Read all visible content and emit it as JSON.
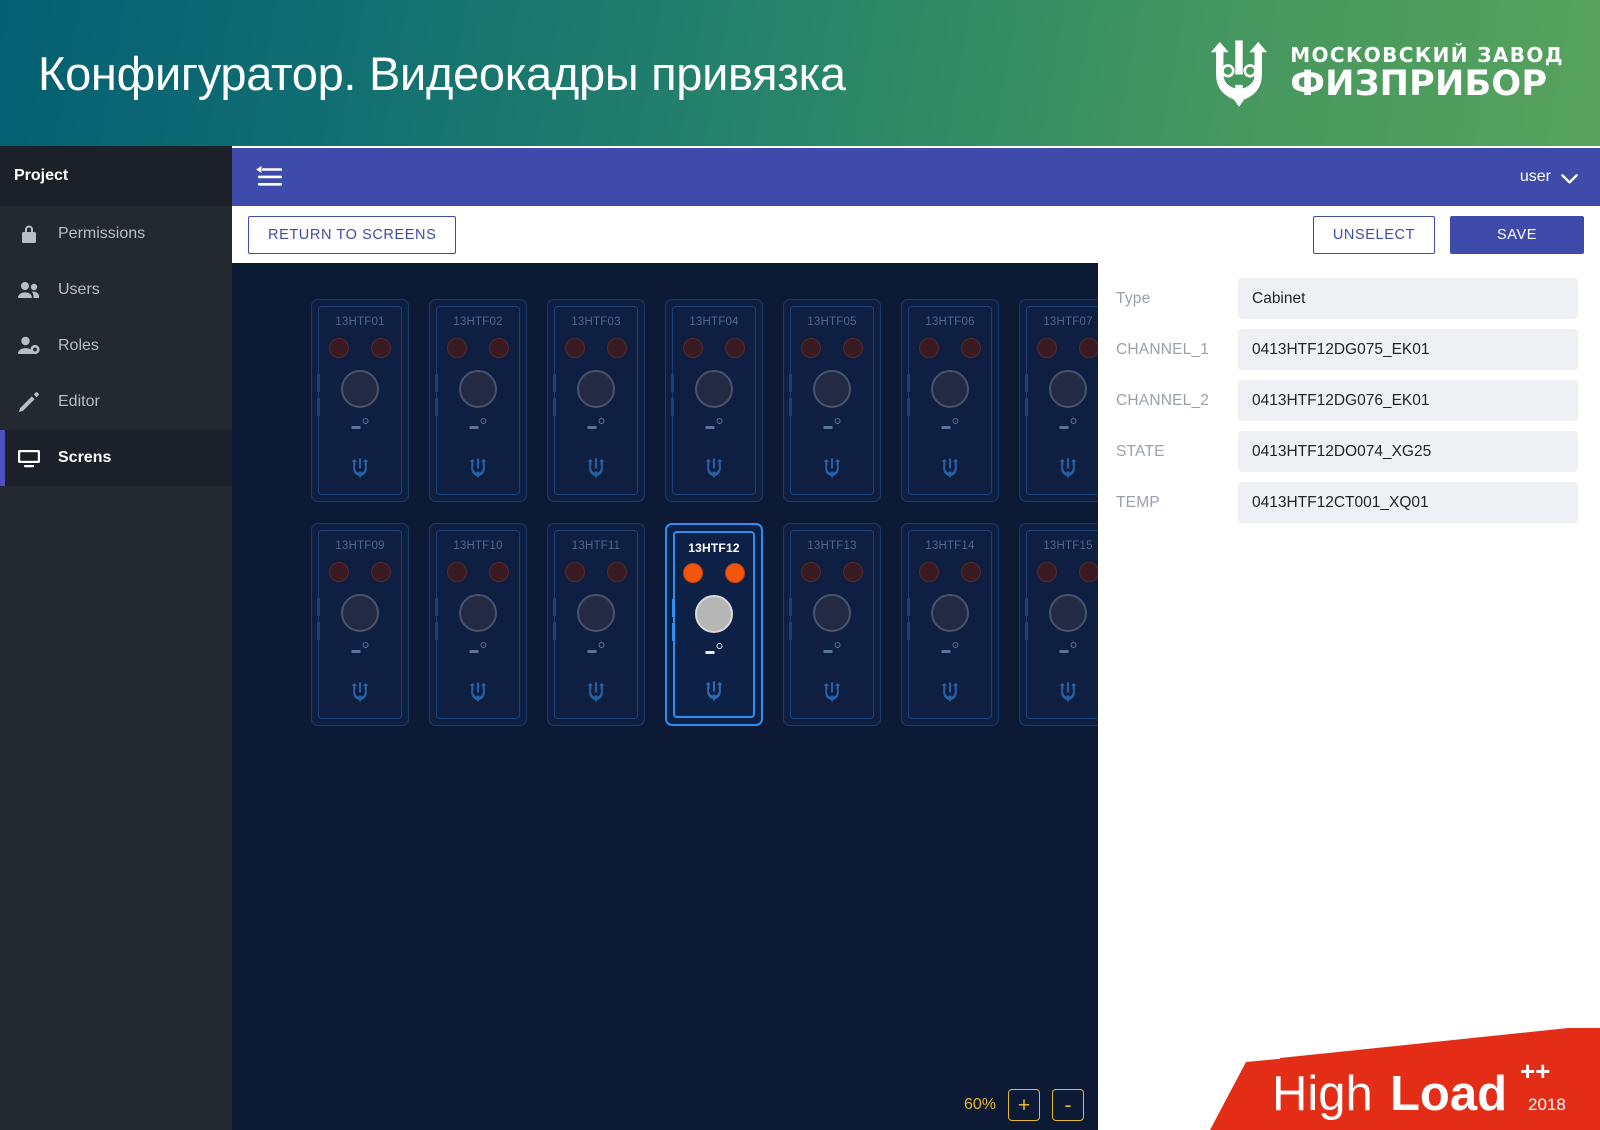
{
  "header": {
    "title": "Конфигуратор. Видеокадры привязка",
    "brand_line1": "МОСКОВСКИЙ ЗАВОД",
    "brand_line2": "ФИЗПРИБОР",
    "brand_logo_icon": "trident-logo-icon",
    "gradient_from": "#035f72",
    "gradient_to": "#57a35d"
  },
  "sidebar": {
    "title": "Project",
    "accent_color": "#4a50c0",
    "items": [
      {
        "label": "Permissions",
        "icon": "lock-icon",
        "active": false
      },
      {
        "label": "Users",
        "icon": "users-icon",
        "active": false
      },
      {
        "label": "Roles",
        "icon": "user-gear-icon",
        "active": false
      },
      {
        "label": "Editor",
        "icon": "pencil-icon",
        "active": false
      },
      {
        "label": "Screns",
        "icon": "monitor-icon",
        "active": true
      }
    ]
  },
  "appbar": {
    "menu_icon": "collapse-menu-icon",
    "user_label": "user",
    "chevron_icon": "chevron-down-icon",
    "background": "#3f4bab"
  },
  "actionbar": {
    "return_label": "RETURN TO SCREENS",
    "unselect_label": "UNSELECT",
    "save_label": "SAVE"
  },
  "canvas": {
    "background": "#0c1a36",
    "zoom_level": "60%",
    "zoom_in_label": "+",
    "zoom_out_label": "-",
    "selected_id": "13HTF12",
    "cabinets": [
      {
        "id": "13HTF01",
        "selected": false
      },
      {
        "id": "13HTF02",
        "selected": false
      },
      {
        "id": "13HTF03",
        "selected": false
      },
      {
        "id": "13HTF04",
        "selected": false
      },
      {
        "id": "13HTF05",
        "selected": false
      },
      {
        "id": "13HTF06",
        "selected": false
      },
      {
        "id": "13HTF07",
        "selected": false
      },
      {
        "id": "13HTF09",
        "selected": false
      },
      {
        "id": "13HTF10",
        "selected": false
      },
      {
        "id": "13HTF11",
        "selected": false
      },
      {
        "id": "13HTF12",
        "selected": true
      },
      {
        "id": "13HTF13",
        "selected": false
      },
      {
        "id": "13HTF14",
        "selected": false
      },
      {
        "id": "13HTF15",
        "selected": false
      }
    ]
  },
  "properties": [
    {
      "label": "Type",
      "value": "Cabinet"
    },
    {
      "label": "CHANNEL_1",
      "value": "0413HTF12DG075_EK01"
    },
    {
      "label": "CHANNEL_2",
      "value": "0413HTF12DG076_EK01"
    },
    {
      "label": "STATE",
      "value": "0413HTF12DO074_XG25"
    },
    {
      "label": "TEMP",
      "value": "0413HTF12CT001_XQ01"
    }
  ],
  "badge": {
    "text_light": "High",
    "text_bold": "Load",
    "plus": "++",
    "year": "2018",
    "color": "#e42d17"
  }
}
